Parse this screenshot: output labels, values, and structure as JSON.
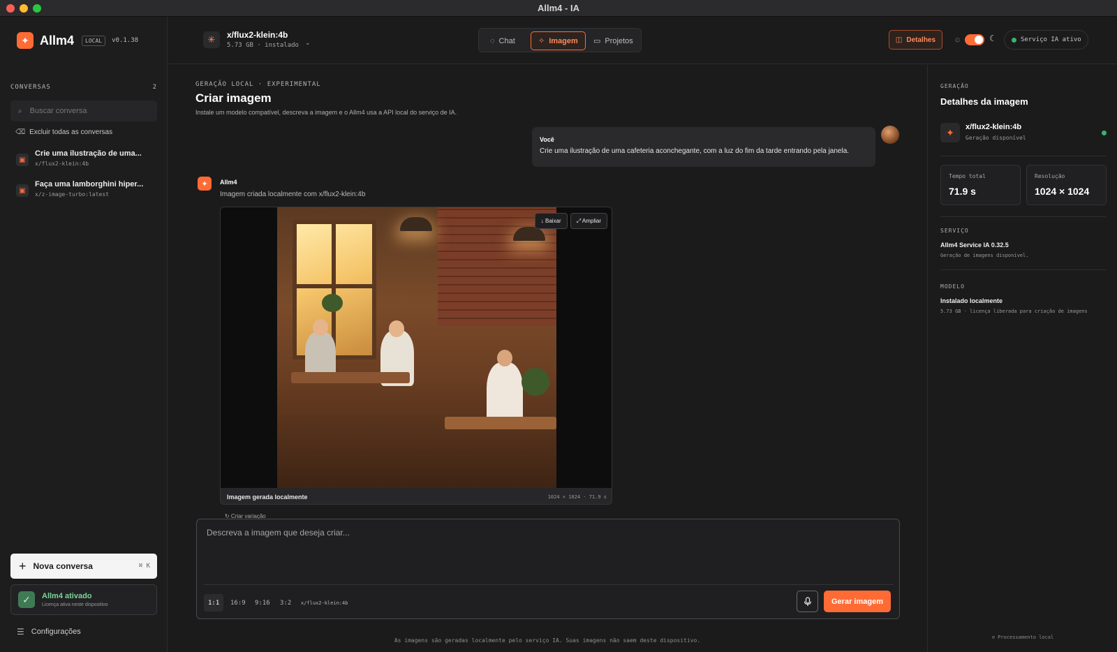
{
  "window": {
    "title": "Allm4 - IA"
  },
  "sidebar": {
    "brand_name": "Allm4",
    "brand_badge": "LOCAL",
    "version": "v0.1.38",
    "conversations_label": "CONVERSAS",
    "conversations_count": "2",
    "search_placeholder": "Buscar conversa",
    "clear_all_label": "Excluir todas as conversas",
    "conversations": [
      {
        "title": "Crie uma ilustração de uma...",
        "model": "x/flux2-klein:4b"
      },
      {
        "title": "Faça uma lamborghini hiper...",
        "model": "x/z-image-turbo:latest"
      }
    ],
    "new_conversation_label": "Nova conversa",
    "new_conversation_shortcut": "⌘ K",
    "activation_title": "Allm4 ativado",
    "activation_sub": "Licença ativa neste dispositivo",
    "settings_label": "Configurações"
  },
  "topbar": {
    "model_name": "x/flux2-klein:4b",
    "model_sub": "5.73 GB · instalado",
    "tabs": [
      {
        "label": "Chat"
      },
      {
        "label": "Imagem"
      },
      {
        "label": "Projetos"
      }
    ],
    "details_label": "Detalhes",
    "service_status": "Serviço IA ativo",
    "accent": "#ff6b35"
  },
  "main": {
    "eyebrow": "GERAÇÃO LOCAL · EXPERIMENTAL",
    "title": "Criar imagem",
    "subtitle": "Instale um modelo compatível, descreva a imagem e o Allm4 usa a API local do serviço de IA.",
    "user_label": "Você",
    "user_message": "Crie uma ilustração de uma cafeteria aconchegante, com a luz do fim da tarde entrando pela janela.",
    "bot_name": "Allm4",
    "bot_sub": "Imagem criada localmente com x/flux2-klein:4b",
    "download_label": "↓ Baixar",
    "expand_label": "⤢ Ampliar",
    "image_caption": "Imagem gerada localmente",
    "image_meta": "1024 × 1024 · 71.9 s",
    "variation_label": "↻ Criar variação",
    "composer_placeholder": "Descreva a imagem que deseja criar...",
    "ratios": [
      "1:1",
      "16:9",
      "9:16",
      "3:2"
    ],
    "composer_model": "x/flux2-klein:4b",
    "generate_label": "Gerar imagem",
    "disclaimer": "As imagens são geradas localmente pelo serviço IA. Suas imagens não saem deste dispositivo."
  },
  "panel": {
    "eyebrow": "GERAÇÃO",
    "title": "Detalhes da imagem",
    "model_name": "x/flux2-klein:4b",
    "model_status": "Geração disponível",
    "total_time_label": "Tempo total",
    "total_time_value": "71.9 s",
    "resolution_label": "Resolução",
    "resolution_value": "1024 × 1024",
    "service_eyebrow": "SERVIÇO",
    "service_name": "Allm4 Service IA 0.32.5",
    "service_sub": "Geração de imagens disponível.",
    "model_eyebrow": "MODELO",
    "model_install": "Instalado localmente",
    "model_license": "5.73 GB · licença liberada para criação de imagens",
    "footer": "⊙ Processamento local"
  }
}
